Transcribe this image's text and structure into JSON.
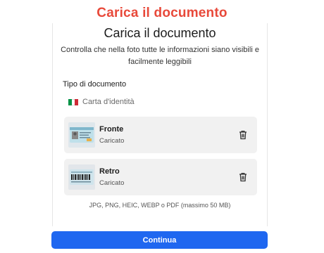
{
  "header": {
    "title": "Carica il documento"
  },
  "card": {
    "title": "Carica il documento",
    "subtitle": "Controlla che nella foto tutte le informazioni siano visibili e facilmente leggibili",
    "doc_type_label": "Tipo di documento",
    "doc_type_value": "Carta d'identità",
    "flag_colors": [
      "#009246",
      "#ffffff",
      "#ce2b37"
    ],
    "sides": [
      {
        "title": "Fronte",
        "status": "Caricato",
        "thumbnail": "id-card-front-icon"
      },
      {
        "title": "Retro",
        "status": "Caricato",
        "thumbnail": "id-card-back-icon"
      }
    ],
    "formats_note": "JPG, PNG, HEIC, WEBP o PDF (massimo 50 MB)"
  },
  "actions": {
    "continue_label": "Continua"
  },
  "colors": {
    "title_accent": "#e8493a",
    "primary_button": "#1f67f0",
    "side_card_bg": "#f1f1f1"
  },
  "icons": {
    "delete": "trash-icon"
  }
}
